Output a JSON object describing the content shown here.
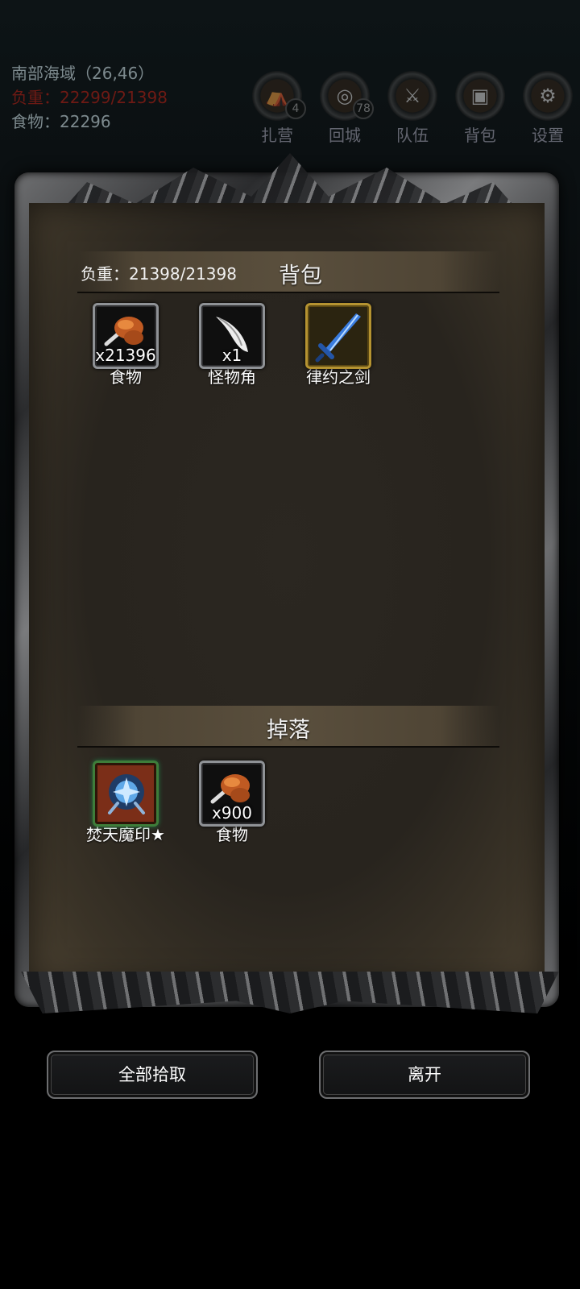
{
  "hud": {
    "location": "南部海域（26,46）",
    "weight": "负重：22299/21398",
    "food": "食物：22296",
    "buttons": [
      {
        "label": "扎营",
        "badge": "4",
        "icon": "camp-icon"
      },
      {
        "label": "回城",
        "badge": "78",
        "icon": "portal-icon"
      },
      {
        "label": "队伍",
        "icon": "team-icon"
      },
      {
        "label": "背包",
        "icon": "backpack-icon"
      },
      {
        "label": "设置",
        "icon": "gear-icon"
      }
    ]
  },
  "bag": {
    "weight": "负重：21398/21398",
    "title": "背包",
    "items": [
      {
        "name": "食物",
        "qty": "x21396",
        "icon": "meat-icon"
      },
      {
        "name": "怪物角",
        "qty": "x1",
        "icon": "horn-icon"
      },
      {
        "name": "律约之剑",
        "qty": "",
        "icon": "sword-icon",
        "rarity_color": "#b59331"
      }
    ]
  },
  "drops": {
    "title": "掉落",
    "items": [
      {
        "name": "焚天魔印★",
        "qty": "",
        "icon": "demon-seal-icon",
        "rarity_color": "#3e7d3a"
      },
      {
        "name": "食物",
        "qty": "x900",
        "icon": "meat-icon"
      }
    ]
  },
  "actions": {
    "pickup_all": "全部拾取",
    "leave": "离开"
  }
}
